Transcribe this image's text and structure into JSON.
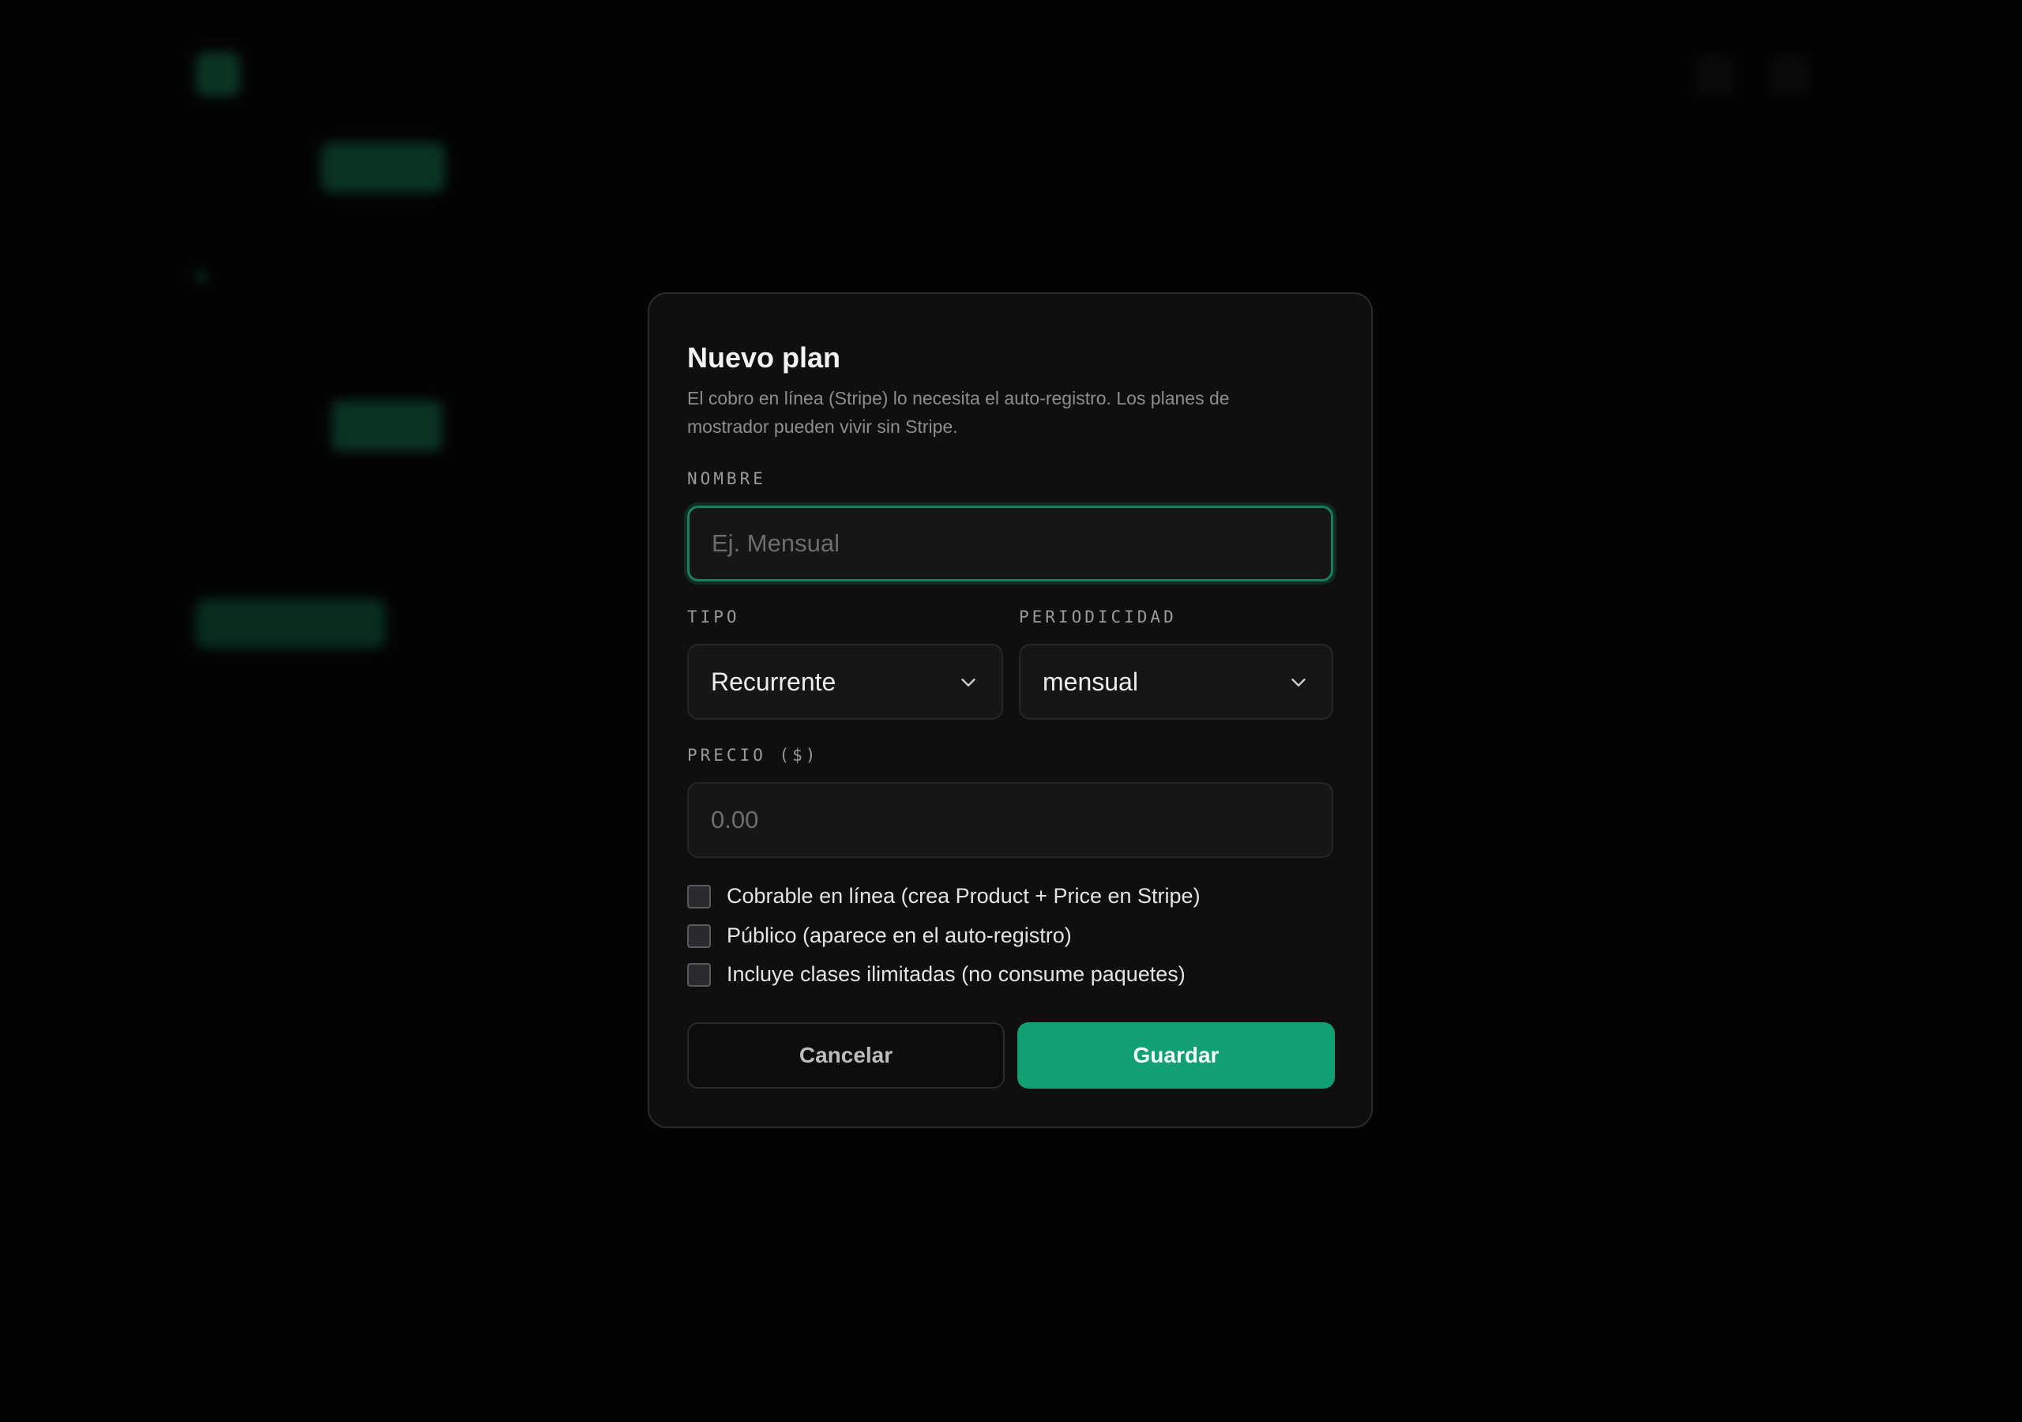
{
  "modal": {
    "title": "Nuevo plan",
    "description": "El cobro en línea (Stripe) lo necesita el auto-registro. Los planes de mostrador pueden vivir sin Stripe.",
    "nombre": {
      "label": "NOMBRE",
      "value": "",
      "placeholder": "Ej. Mensual"
    },
    "tipo": {
      "label": "TIPO",
      "value": "Recurrente",
      "icon": "chevron-down-icon"
    },
    "periodicidad": {
      "label": "PERIODICIDAD",
      "value": "mensual",
      "icon": "chevron-down-icon"
    },
    "precio": {
      "label": "PRECIO ($)",
      "value": "",
      "placeholder": "0.00"
    },
    "checkboxes": [
      {
        "label": "Cobrable en línea (crea Product + Price en Stripe)",
        "checked": false
      },
      {
        "label": "Público (aparece en el auto-registro)",
        "checked": false
      },
      {
        "label": "Incluye clases ilimitadas (no consume paquetes)",
        "checked": false
      }
    ],
    "buttons": {
      "cancel": "Cancelar",
      "save": "Guardar"
    }
  },
  "colors": {
    "accent": "#12a072",
    "focus_ring": "#15805a",
    "modal_bg": "#0f0f10",
    "page_bg": "#050505"
  }
}
